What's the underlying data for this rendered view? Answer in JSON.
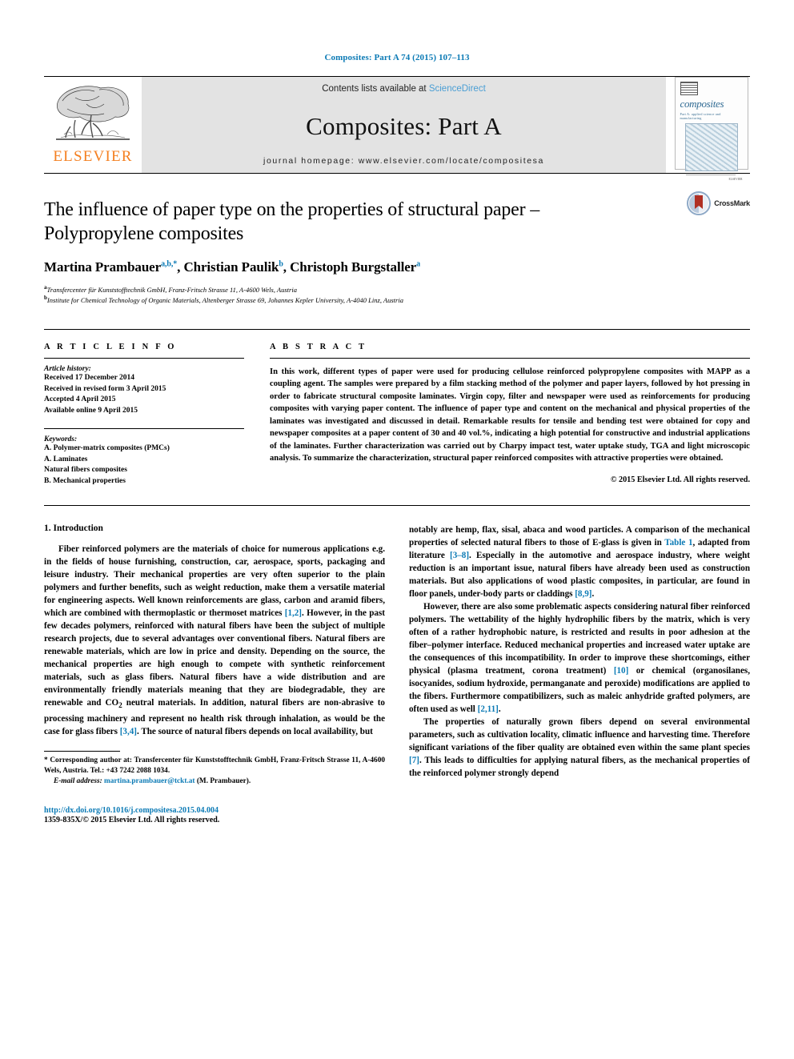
{
  "running_head": "Composites: Part A 74 (2015) 107–113",
  "masthead": {
    "publisher": "ELSEVIER",
    "contents_prefix": "Contents lists available at ",
    "contents_link": "ScienceDirect",
    "journal_title": "Composites: Part A",
    "homepage": "journal homepage: www.elsevier.com/locate/compositesa",
    "cover": {
      "name": "composites",
      "subtitle": "Part A: applied science and manufacturing"
    }
  },
  "article": {
    "title": "The influence of paper type on the properties of structural paper – Polypropylene composites",
    "authors": [
      {
        "name": "Martina Prambauer",
        "marks": "a,b,*"
      },
      {
        "name": "Christian Paulik",
        "marks": "b"
      },
      {
        "name": "Christoph Burgstaller",
        "marks": "a"
      }
    ],
    "affiliations": [
      {
        "mark": "a",
        "text": "Transfercenter für Kunststofftechnik GmbH, Franz-Fritsch Strasse 11, A-4600 Wels, Austria"
      },
      {
        "mark": "b",
        "text": "Institute for Chemical Technology of Organic Materials, Altenberger Strasse 69, Johannes Kepler University, A-4040 Linz, Austria"
      }
    ],
    "crossmark_label": "CrossMark"
  },
  "info": {
    "heading": "A R T I C L E  I N F O",
    "history_label": "Article history:",
    "history": [
      "Received 17 December 2014",
      "Received in revised form 3 April 2015",
      "Accepted 4 April 2015",
      "Available online 9 April 2015"
    ],
    "keywords_label": "Keywords:",
    "keywords": [
      "A. Polymer-matrix composites (PMCs)",
      "A. Laminates",
      "Natural fibers composites",
      "B. Mechanical properties"
    ]
  },
  "abstract": {
    "heading": "A B S T R A C T",
    "text": "In this work, different types of paper were used for producing cellulose reinforced polypropylene composites with MAPP as a coupling agent. The samples were prepared by a film stacking method of the polymer and paper layers, followed by hot pressing in order to fabricate structural composite laminates. Virgin copy, filter and newspaper were used as reinforcements for producing composites with varying paper content. The influence of paper type and content on the mechanical and physical properties of the laminates was investigated and discussed in detail. Remarkable results for tensile and bending test were obtained for copy and newspaper composites at a paper content of 30 and 40 vol.%, indicating a high potential for constructive and industrial applications of the laminates. Further characterization was carried out by Charpy impact test, water uptake study, TGA and light microscopic analysis. To summarize the characterization, structural paper reinforced composites with attractive properties were obtained.",
    "copyright": "© 2015 Elsevier Ltd. All rights reserved."
  },
  "body": {
    "section_title": "1. Introduction",
    "left_paragraphs": [
      "Fiber reinforced polymers are the materials of choice for numerous applications e.g. in the fields of house furnishing, construction, car, aerospace, sports, packaging and leisure industry. Their mechanical properties are very often superior to the plain polymers and further benefits, such as weight reduction, make them a versatile material for engineering aspects. Well known reinforcements are glass, carbon and aramid fibers, which are combined with thermoplastic or thermoset matrices [1,2]. However, in the past few decades polymers, reinforced with natural fibers have been the subject of multiple research projects, due to several advantages over conventional fibers. Natural fibers are renewable materials, which are low in price and density. Depending on the source, the mechanical properties are high enough to compete with synthetic reinforcement materials, such as glass fibers. Natural fibers have a wide distribution and are environmentally friendly materials meaning that they are biodegradable, they are renewable and CO2 neutral materials. In addition, natural fibers are non-abrasive to processing machinery and represent no health risk through inhalation, as would be the case for glass fibers [3,4]. The source of natural fibers depends on local availability, but"
    ],
    "right_paragraphs": [
      "notably are hemp, flax, sisal, abaca and wood particles. A comparison of the mechanical properties of selected natural fibers to those of E-glass is given in Table 1, adapted from literature [3–8]. Especially in the automotive and aerospace industry, where weight reduction is an important issue, natural fibers have already been used as construction materials. But also applications of wood plastic composites, in particular, are found in floor panels, under-body parts or claddings [8,9].",
      "However, there are also some problematic aspects considering natural fiber reinforced polymers. The wettability of the highly hydrophilic fibers by the matrix, which is very often of a rather hydrophobic nature, is restricted and results in poor adhesion at the fiber–polymer interface. Reduced mechanical properties and increased water uptake are the consequences of this incompatibility. In order to improve these shortcomings, either physical (plasma treatment, corona treatment) [10] or chemical (organosilanes, isocyanides, sodium hydroxide, permanganate and peroxide) modifications are applied to the fibers. Furthermore compatibilizers, such as maleic anhydride grafted polymers, are often used as well [2,11].",
      "The properties of naturally grown fibers depend on several environmental parameters, such as cultivation locality, climatic influence and harvesting time. Therefore significant variations of the fiber quality are obtained even within the same plant species [7]. This leads to difficulties for applying natural fibers, as the mechanical properties of the reinforced polymer strongly depend"
    ]
  },
  "footnote": {
    "corresponding": "* Corresponding author at: Transfercenter für Kunststofftechnik GmbH, Franz-Fritsch Strasse 11, A-4600 Wels, Austria. Tel.: +43 7242 2088 1034.",
    "email_label": "E-mail address:",
    "email": "martina.prambauer@tckt.at",
    "email_suffix": " (M. Prambauer)."
  },
  "footer": {
    "doi": "http://dx.doi.org/10.1016/j.compositesa.2015.04.004",
    "issn": "1359-835X/© 2015 Elsevier Ltd. All rights reserved."
  },
  "colors": {
    "link_blue": "#0b7ab5",
    "sciencedirect_blue": "#4a9ed4",
    "elsevier_orange": "#f47f20",
    "band_gray": "#e3e3e3"
  }
}
